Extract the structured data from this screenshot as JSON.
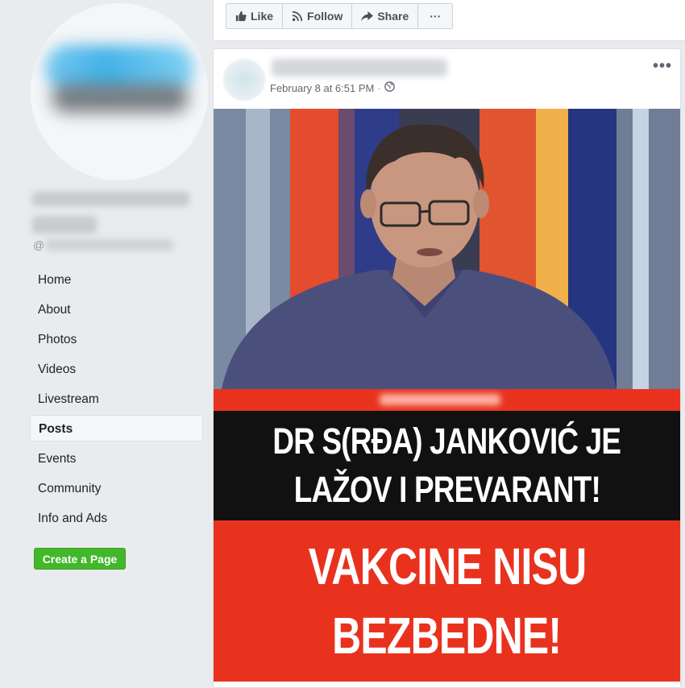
{
  "sidebar": {
    "handle_prefix": "@",
    "nav": [
      "Home",
      "About",
      "Photos",
      "Videos",
      "Livestream",
      "Posts",
      "Events",
      "Community",
      "Info and Ads"
    ],
    "active_index": 5,
    "create_page_label": "Create a Page"
  },
  "actions": {
    "like": "Like",
    "follow": "Follow",
    "share": "Share",
    "more": "···"
  },
  "post": {
    "timestamp": "February 8 at 6:51 PM",
    "separator": "·",
    "privacy_icon": "globe-icon",
    "more": "•••",
    "image_caption_line1": "DR S(RĐA) JANKOVIĆ JE",
    "image_caption_line2": "LAŽOV I PREVARANT!",
    "image_caption_line3": "VAKCINE NISU",
    "image_caption_line4": "BEZBEDNE!"
  },
  "colors": {
    "page_bg": "#e9ebee",
    "create_button": "#42b72a",
    "banner_red": "#e8321e",
    "banner_black": "#111111"
  }
}
